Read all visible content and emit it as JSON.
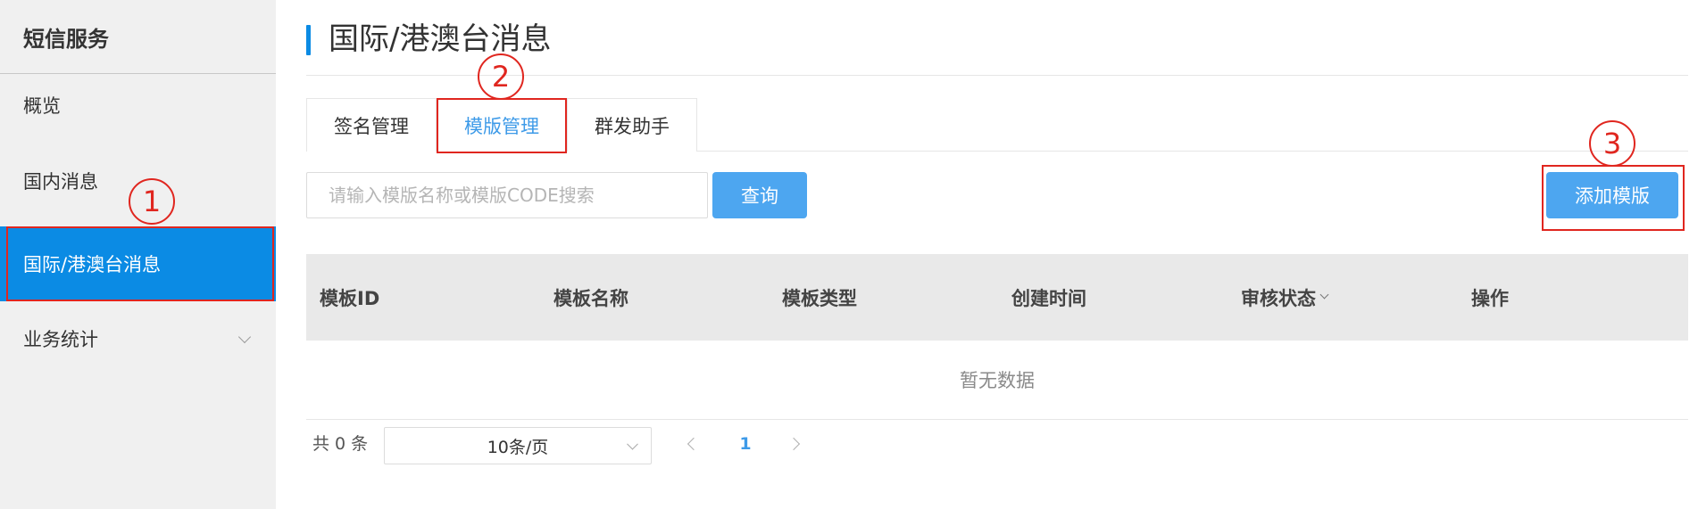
{
  "sidebar": {
    "title": "短信服务",
    "items": [
      {
        "label": "概览"
      },
      {
        "label": "国内消息"
      },
      {
        "label": "国际/港澳台消息"
      },
      {
        "label": "业务统计"
      }
    ]
  },
  "main": {
    "title": "国际/港澳台消息",
    "tabs": [
      {
        "label": "签名管理"
      },
      {
        "label": "模版管理"
      },
      {
        "label": "群发助手"
      }
    ],
    "search": {
      "placeholder": "请输入模版名称或模版CODE搜索",
      "value": "",
      "button_label": "查询"
    },
    "add_button_label": "添加模版",
    "table": {
      "columns": [
        "模板ID",
        "模板名称",
        "模板类型",
        "创建时间",
        "审核状态",
        "操作"
      ],
      "empty_text": "暂无数据"
    },
    "pagination": {
      "total_text": "共 0 条",
      "page_size": "10条/页",
      "current_page": "1"
    }
  },
  "annotations": {
    "step1": "1",
    "step2": "2",
    "step3": "3"
  },
  "colors": {
    "accent": "#0b8be4",
    "button": "#4da6f0",
    "annotation": "#e0261f"
  }
}
